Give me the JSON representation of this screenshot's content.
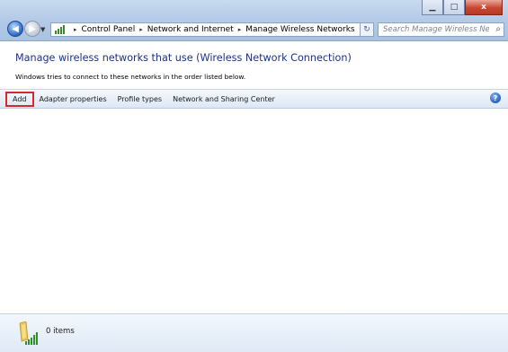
{
  "window": {
    "minimize_label": "▁",
    "maximize_label": "□",
    "close_label": "x"
  },
  "address_bar": {
    "breadcrumbs": [
      "Control Panel",
      "Network and Internet",
      "Manage Wireless Networks"
    ],
    "separator": "▸"
  },
  "search": {
    "placeholder": "Search Manage Wireless Networks"
  },
  "header": {
    "title": "Manage wireless networks that use (Wireless Network Connection)",
    "subtitle": "Windows tries to connect to these networks in the order listed below."
  },
  "commandbar": {
    "add": "Add",
    "adapter_properties": "Adapter properties",
    "profile_types": "Profile types",
    "network_sharing_center": "Network and Sharing Center",
    "help": "?"
  },
  "details": {
    "item_count": "0 items"
  },
  "icons": {
    "back": "back-arrow-icon",
    "forward": "forward-arrow-icon",
    "refresh": "refresh-icon",
    "search": "search-icon",
    "help": "help-icon",
    "network": "wireless-network-icon"
  },
  "colors": {
    "title": "#1e3287",
    "highlight": "#d22b2b"
  }
}
